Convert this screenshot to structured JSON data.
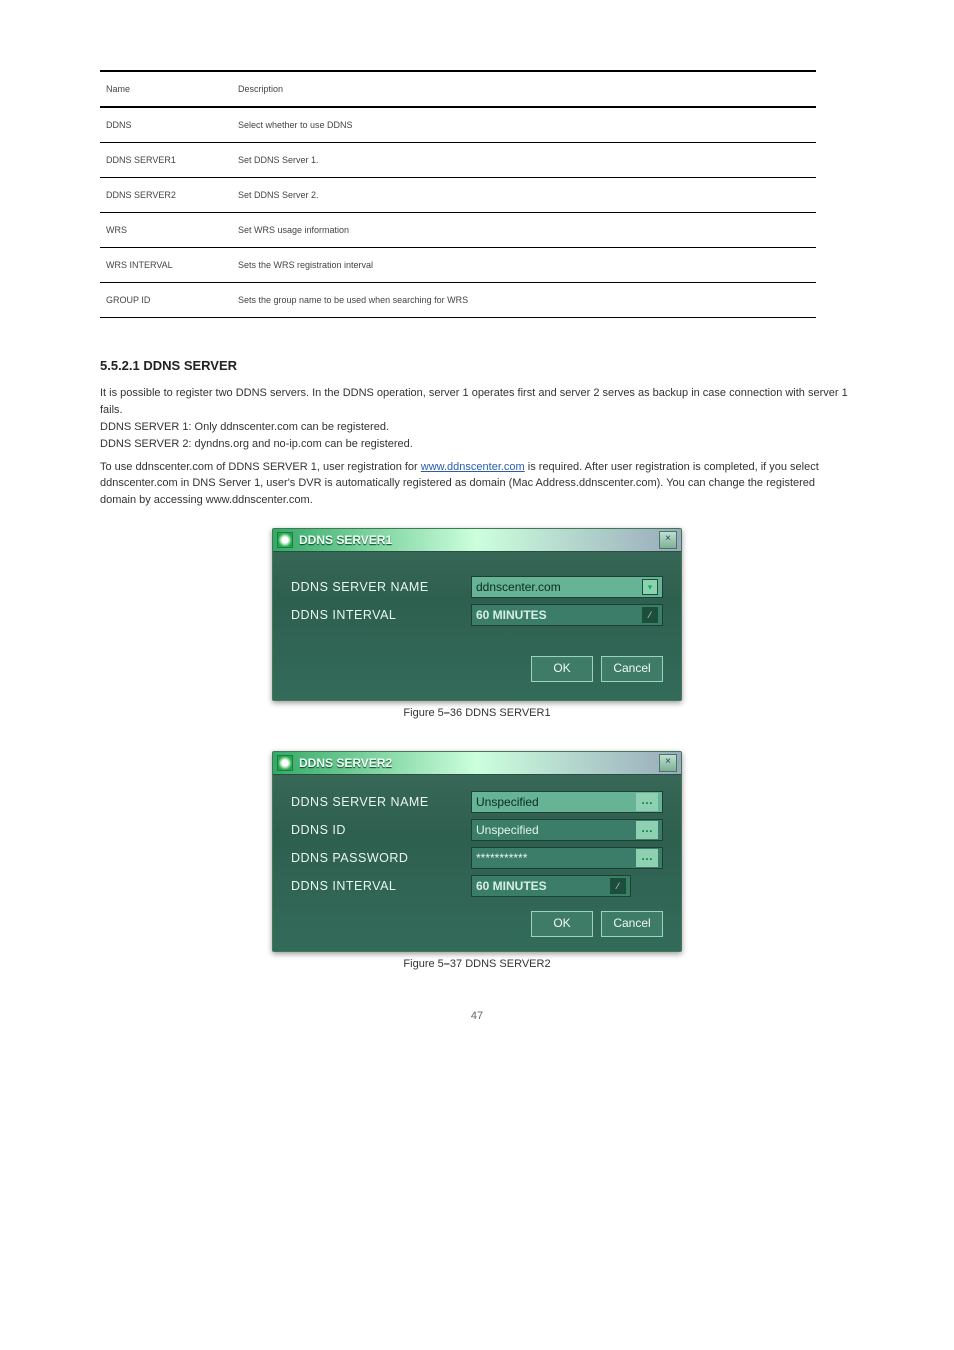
{
  "table": {
    "rows": [
      {
        "k": "Name",
        "v": "Description"
      },
      {
        "k": "DDNS",
        "v": "Select whether to use DDNS"
      },
      {
        "k": "DDNS SERVER1",
        "v": "Set DDNS Server 1."
      },
      {
        "k": "DDNS SERVER2",
        "v": "Set DDNS Server 2."
      },
      {
        "k": "WRS",
        "v": "Set WRS usage information"
      },
      {
        "k": "WRS INTERVAL",
        "v": "Sets the WRS registration interval"
      },
      {
        "k": "GROUP ID",
        "v": "Sets the group name to be used when searching for WRS"
      }
    ]
  },
  "section": {
    "heading": "5.5.2.1 DDNS SERVER",
    "p1": "It is possible to register two DDNS servers. In the DDNS operation, server 1 operates first and server 2 serves as backup in case connection with server 1 fails.",
    "bullets": [
      "DDNS SERVER 1: Only ddnscenter.com can be registered.",
      "DDNS SERVER 2: dyndns.org and no-ip.com can be registered."
    ],
    "p2_pre": "To use ddnscenter.com of DDNS SERVER 1, user registration for ",
    "p2_link": "www.ddnscenter.com",
    "p2_post": " is required. After user registration is completed, if you select ddnscenter.com in DNS Server 1, user's DVR is automatically registered as domain (Mac Address.ddnscenter.com). You can change the registered domain by accessing www.ddnscenter.com."
  },
  "dlg1": {
    "title": "DDNS SERVER1",
    "rows": [
      {
        "label": "DDNS SERVER NAME",
        "value": "ddnscenter.com",
        "type": "dropdown-highlight"
      },
      {
        "label": "DDNS INTERVAL",
        "value": "60 MINUTES",
        "type": "text"
      }
    ],
    "ok": "OK",
    "cancel": "Cancel",
    "caption_pre": "Figure 5",
    "caption_dash": "–",
    "caption_post": "36 DDNS SERVER1"
  },
  "dlg2": {
    "title": "DDNS SERVER2",
    "rows": [
      {
        "label": "DDNS SERVER NAME",
        "value": "Unspecified",
        "type": "ellipsis-highlight"
      },
      {
        "label": "DDNS ID",
        "value": "Unspecified",
        "type": "ellipsis"
      },
      {
        "label": "DDNS PASSWORD",
        "value": "***********",
        "type": "ellipsis"
      },
      {
        "label": "DDNS INTERVAL",
        "value": "60 MINUTES",
        "type": "text-short"
      }
    ],
    "ok": "OK",
    "cancel": "Cancel",
    "caption_pre": "Figure 5",
    "caption_dash": "–",
    "caption_post": "37 DDNS SERVER2"
  },
  "pagenum": "47"
}
